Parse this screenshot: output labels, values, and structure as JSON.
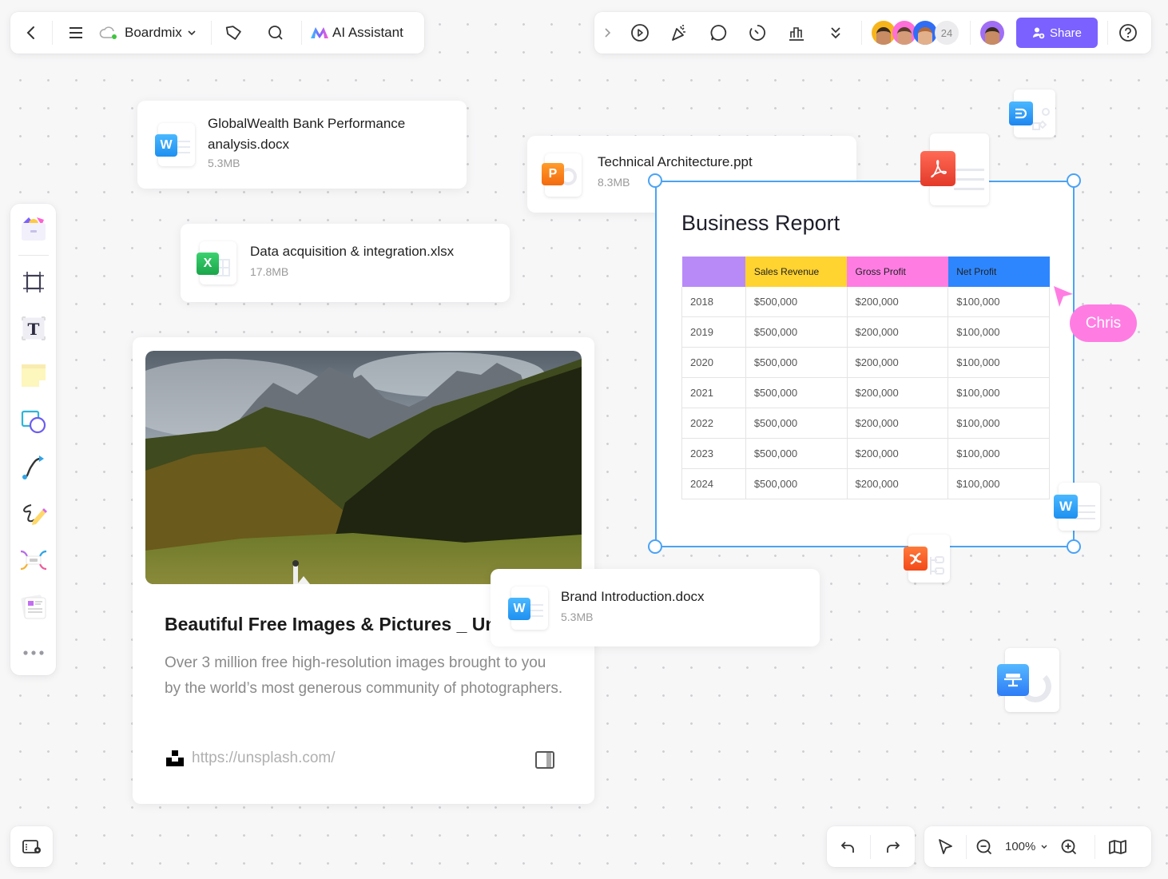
{
  "toolbar_left": {
    "back_icon": "chevron-left-icon",
    "menu_icon": "hamburger-icon",
    "board_name": "Boardmix",
    "sync_status": "saved",
    "ai_label": "AI Assistant"
  },
  "toolbar_right": {
    "collaborator_count": "24",
    "share_label": "Share",
    "accent_color": "#7b61ff"
  },
  "files": [
    {
      "name_line1": "GlobalWealth Bank Performance",
      "name_line2": "analysis.docx",
      "size": "5.3MB",
      "type": "W"
    },
    {
      "name": "Data acquisition & integration.xlsx",
      "size": "17.8MB",
      "type": "X"
    },
    {
      "name": "Technical Architecture.ppt",
      "size": "8.3MB",
      "type": "P"
    },
    {
      "name": "Brand Introduction.docx",
      "size": "5.3MB",
      "type": "W"
    }
  ],
  "report": {
    "title": "Business Report",
    "headers": [
      "",
      "Sales Revenue",
      "Gross Profit",
      "Net Profit"
    ],
    "header_colors": [
      "#b88af8",
      "#ffd330",
      "#ff7de3",
      "#2e86ff"
    ],
    "rows": [
      [
        "2018",
        "$500,000",
        "$200,000",
        "$100,000"
      ],
      [
        "2019",
        "$500,000",
        "$200,000",
        "$100,000"
      ],
      [
        "2020",
        "$500,000",
        "$200,000",
        "$100,000"
      ],
      [
        "2021",
        "$500,000",
        "$200,000",
        "$100,000"
      ],
      [
        "2022",
        "$500,000",
        "$200,000",
        "$100,000"
      ],
      [
        "2023",
        "$500,000",
        "$200,000",
        "$100,000"
      ],
      [
        "2024",
        "$500,000",
        "$200,000",
        "$100,000"
      ]
    ]
  },
  "cursor": {
    "user": "Chris",
    "color": "#ff7de3"
  },
  "link_card": {
    "title": "Beautiful Free Images & Pictures _ Unsplash",
    "description": "Over 3 million free high-resolution images brought to you by the world’s most generous community of photographers.",
    "url": "https://unsplash.com/"
  },
  "bottom_bar": {
    "zoom_level": "100%"
  }
}
